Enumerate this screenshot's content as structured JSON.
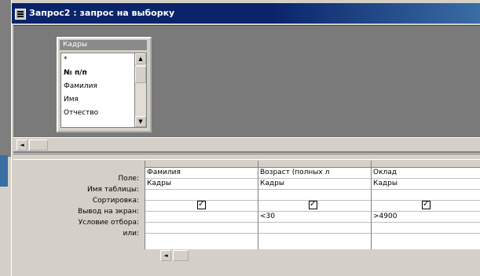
{
  "window": {
    "title": "Запрос2 : запрос на выборку"
  },
  "table_box": {
    "name": "Кадры",
    "fields": [
      "*",
      "№ п/п",
      "Фамилия",
      "Имя",
      "Отчество"
    ]
  },
  "grid": {
    "row_labels": [
      "Поле:",
      "Имя таблицы:",
      "Сортировка:",
      "Вывод на экран:",
      "Условие отбора:",
      "или:"
    ],
    "columns": [
      {
        "field": "Фамилия",
        "table": "Кадры",
        "sort": "",
        "show": true,
        "criteria": "",
        "or": ""
      },
      {
        "field": "Возраст (полных л",
        "table": "Кадры",
        "sort": "",
        "show": true,
        "criteria": "<30",
        "or": ""
      },
      {
        "field": "Оклад",
        "table": "Кадры",
        "sort": "",
        "show": true,
        "criteria": ">4900",
        "or": ""
      }
    ]
  },
  "icons": {
    "scroll_up": "▲",
    "scroll_down": "▼",
    "scroll_left": "◄"
  }
}
